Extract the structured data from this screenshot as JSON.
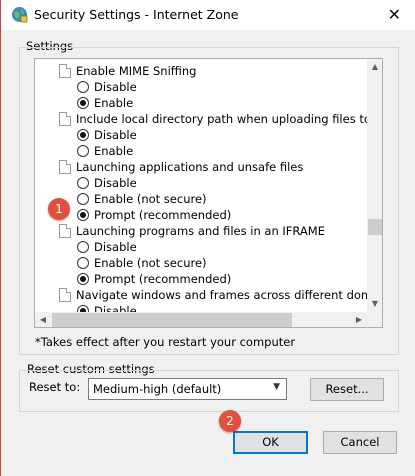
{
  "window": {
    "title": "Security Settings - Internet Zone",
    "close_glyph": "✕"
  },
  "settings": {
    "label": "Settings",
    "items": [
      {
        "type": "header",
        "label": "Enable MIME Sniffing"
      },
      {
        "type": "option",
        "label": "Disable",
        "selected": false
      },
      {
        "type": "option",
        "label": "Enable",
        "selected": true
      },
      {
        "type": "header",
        "label": "Include local directory path when uploading files to a server"
      },
      {
        "type": "option",
        "label": "Disable",
        "selected": true
      },
      {
        "type": "option",
        "label": "Enable",
        "selected": false
      },
      {
        "type": "header",
        "label": "Launching applications and unsafe files"
      },
      {
        "type": "option",
        "label": "Disable",
        "selected": false
      },
      {
        "type": "option",
        "label": "Enable (not secure)",
        "selected": false
      },
      {
        "type": "option",
        "label": "Prompt (recommended)",
        "selected": true
      },
      {
        "type": "header",
        "label": "Launching programs and files in an IFRAME"
      },
      {
        "type": "option",
        "label": "Disable",
        "selected": false
      },
      {
        "type": "option",
        "label": "Enable (not secure)",
        "selected": false
      },
      {
        "type": "option",
        "label": "Prompt (recommended)",
        "selected": true
      },
      {
        "type": "header",
        "label": "Navigate windows and frames across different domains"
      },
      {
        "type": "option",
        "label": "Disable",
        "selected": true
      }
    ],
    "footnote": "*Takes effect after you restart your computer"
  },
  "reset": {
    "group_label": "Reset custom settings",
    "reset_to_label": "Reset to:",
    "selected_level": "Medium-high (default)",
    "reset_button": "Reset..."
  },
  "buttons": {
    "ok": "OK",
    "cancel": "Cancel"
  },
  "annotations": {
    "step1": "1",
    "step2": "2",
    "badge_color": "#e0503c"
  },
  "icons": {
    "title": "globe-shield-icon",
    "setting": "document-icon",
    "scroll_up": "▲",
    "scroll_down": "▼",
    "scroll_left": "◀",
    "scroll_right": "▶",
    "dropdown": "chevron-down-icon"
  }
}
